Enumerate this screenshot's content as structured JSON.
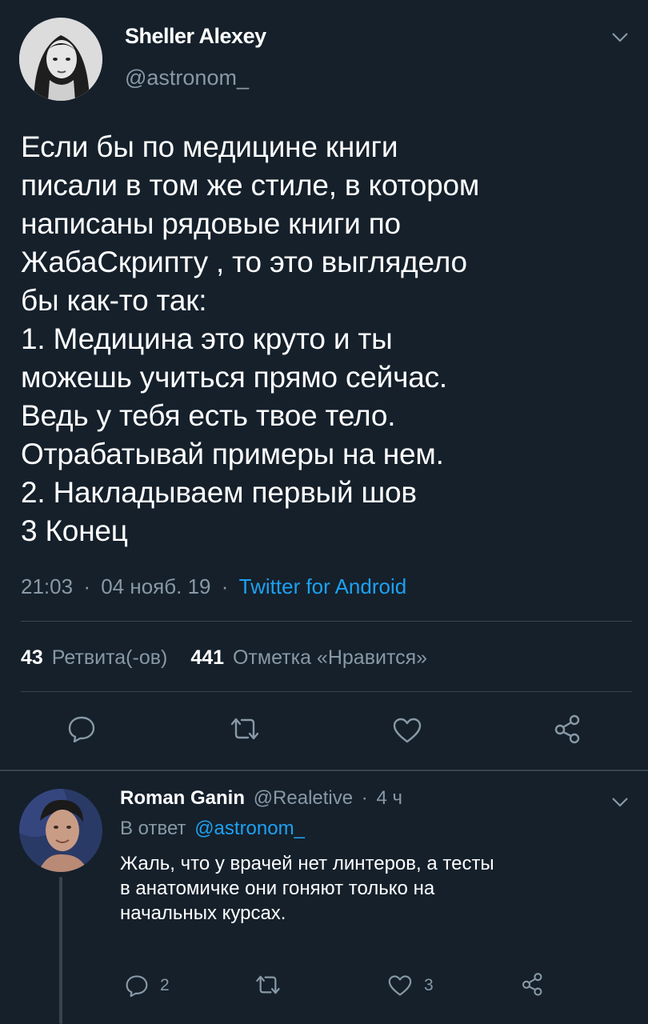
{
  "tweet": {
    "author_name": "Sheller Alexey",
    "author_handle": "@astronom_",
    "text": "Если бы по медицине книги\nписали в том же стиле, в котором\nнаписаны рядовые книги по\nЖабаСкрипту , то это  выглядело\nбы как-то так:\n1. Медицина это круто и ты\nможешь учиться прямо сейчас.\nВедь у тебя есть твое тело.\nОтрабатывай примеры на нем.\n2. Накладываем первый шов\n3 Конец",
    "time": "21:03",
    "date": "04 нояб. 19",
    "separator": "·",
    "source": "Twitter for Android",
    "retweets_count": "43",
    "retweets_label": "Ретвита(-ов)",
    "likes_count": "441",
    "likes_label": "Отметка «Нравится»"
  },
  "reply": {
    "author_name": "Roman Ganin",
    "author_handle": "@Realetive",
    "age": "4 ч",
    "in_reply_prefix": "В ответ",
    "in_reply_handle": "@astronom_",
    "text": "Жаль, что у врачей нет линтеров, а тесты\nв анатомичке они гоняют только на\nначальных курсах.",
    "reply_count": "2",
    "like_count": "3"
  },
  "colors": {
    "background": "#15202b",
    "text": "#ffffff",
    "muted": "#8899a6",
    "accent": "#1da1f2",
    "divider": "#38444d"
  }
}
